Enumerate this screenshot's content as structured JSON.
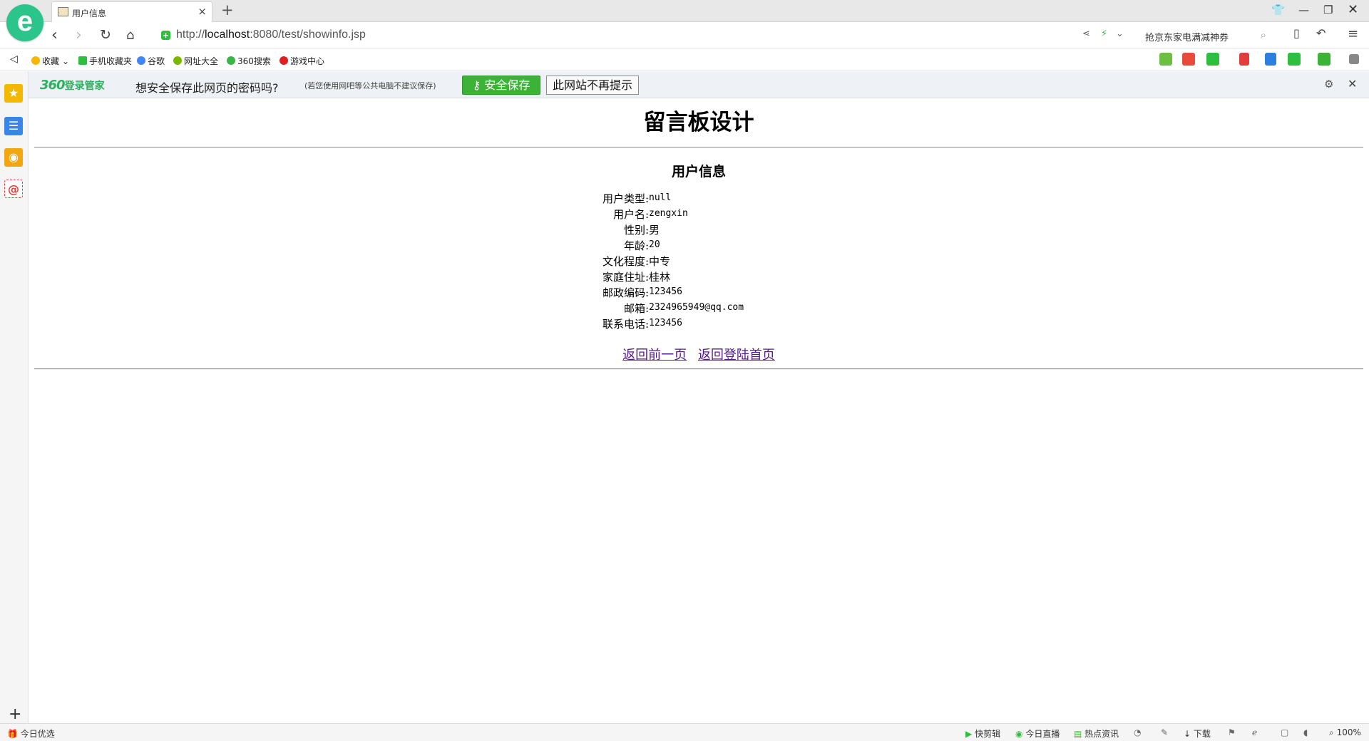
{
  "browser": {
    "tab_title": "用户信息",
    "url_prefix": "http://",
    "url_host": "localhost",
    "url_rest": ":8080/test/showinfo.jsp",
    "search_placeholder": "抢京东家电满减神券"
  },
  "bookmarks": [
    {
      "label": "收藏",
      "icon": "star-icon",
      "color": "#f5b800"
    },
    {
      "label": "手机收藏夹",
      "icon": "phone-icon",
      "color": "#2ebf3f"
    },
    {
      "label": "谷歌",
      "icon": "google-icon",
      "color": "#4285f4"
    },
    {
      "label": "网址大全",
      "icon": "globe-icon",
      "color": "#7ab800"
    },
    {
      "label": "360搜索",
      "icon": "360-search-icon",
      "color": "#39b54a"
    },
    {
      "label": "游戏中心",
      "icon": "game-center-icon",
      "color": "#e02020"
    }
  ],
  "password_bar": {
    "logo_big": "360",
    "logo_text": "登录管家",
    "question": "想安全保存此网页的密码吗?",
    "note": "(若您使用网吧等公共电脑不建议保存)",
    "save_label": "安全保存",
    "never_label": "此网站不再提示"
  },
  "page": {
    "title": "留言板设计",
    "subtitle": "用户信息",
    "fields": [
      {
        "label": "用户类型:",
        "value": "null"
      },
      {
        "label": "用户名:",
        "value": "zengxin"
      },
      {
        "label": "性别:",
        "value": "男"
      },
      {
        "label": "年龄:",
        "value": "20"
      },
      {
        "label": "文化程度:",
        "value": "中专"
      },
      {
        "label": "家庭住址:",
        "value": "桂林"
      },
      {
        "label": "邮政编码:",
        "value": "123456"
      },
      {
        "label": "邮箱:",
        "value": "2324965949@qq.com"
      },
      {
        "label": "联系电话:",
        "value": "123456"
      }
    ],
    "link_back": "返回前一页",
    "link_home": "返回登陆首页"
  },
  "status": {
    "left": "今日优选",
    "items": [
      "快剪辑",
      "今日直播",
      "热点资讯",
      "下载",
      "100%"
    ]
  },
  "colors": {
    "accent_green": "#3cb336",
    "link": "#0000ee",
    "visited": "#551a8b"
  }
}
